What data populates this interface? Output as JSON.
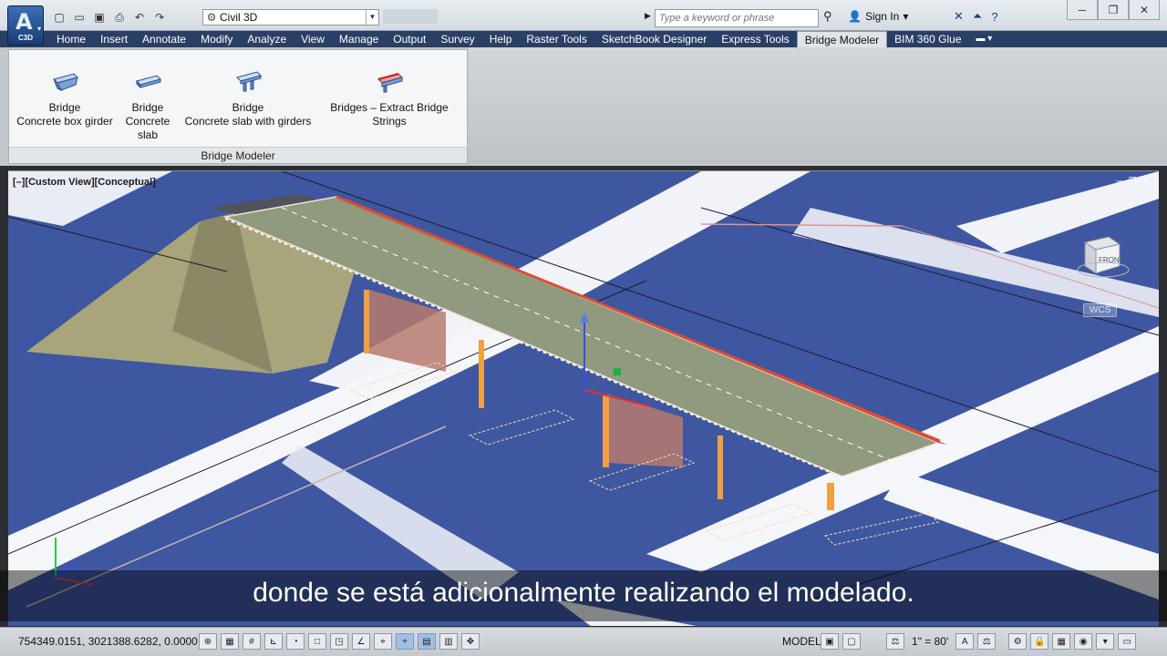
{
  "app": {
    "badge": "C3D",
    "workspace": "Civil 3D",
    "search_placeholder": "Type a keyword or phrase",
    "sign_in": "Sign In"
  },
  "tabs": [
    {
      "label": "Home"
    },
    {
      "label": "Insert"
    },
    {
      "label": "Annotate"
    },
    {
      "label": "Modify"
    },
    {
      "label": "Analyze"
    },
    {
      "label": "View"
    },
    {
      "label": "Manage"
    },
    {
      "label": "Output"
    },
    {
      "label": "Survey"
    },
    {
      "label": "Help"
    },
    {
      "label": "Raster Tools"
    },
    {
      "label": "SketchBook Designer"
    },
    {
      "label": "Express Tools"
    },
    {
      "label": "Bridge Modeler",
      "active": true
    },
    {
      "label": "BIM 360 Glue"
    }
  ],
  "ribbon": {
    "panel_title": "Bridge Modeler",
    "buttons": [
      {
        "line1": "Bridge",
        "line2": "Concrete box girder",
        "icon": "box-girder-icon"
      },
      {
        "line1": "Bridge",
        "line2": "Concrete slab",
        "icon": "slab-icon"
      },
      {
        "line1": "Bridge",
        "line2": "Concrete slab with girders",
        "icon": "slab-girders-icon"
      },
      {
        "line1": "Bridges – Extract Bridge Strings",
        "line2": "",
        "icon": "extract-strings-icon"
      }
    ]
  },
  "viewport": {
    "label": "[–][Custom View][Conceptual]",
    "viewcube_face": "FRONT",
    "wcs": "WCS"
  },
  "subtitle": "donde se está adicionalmente realizando el modelado.",
  "status": {
    "coords": "754349.0151, 3021388.6282, 0.0000",
    "model": "MODEL",
    "scale": "1\" = 80'"
  },
  "colors": {
    "tab_bar": "#2a3f66",
    "viewport_bg": "#3f57a0",
    "ribbon_panel": "#f5f6f7"
  }
}
